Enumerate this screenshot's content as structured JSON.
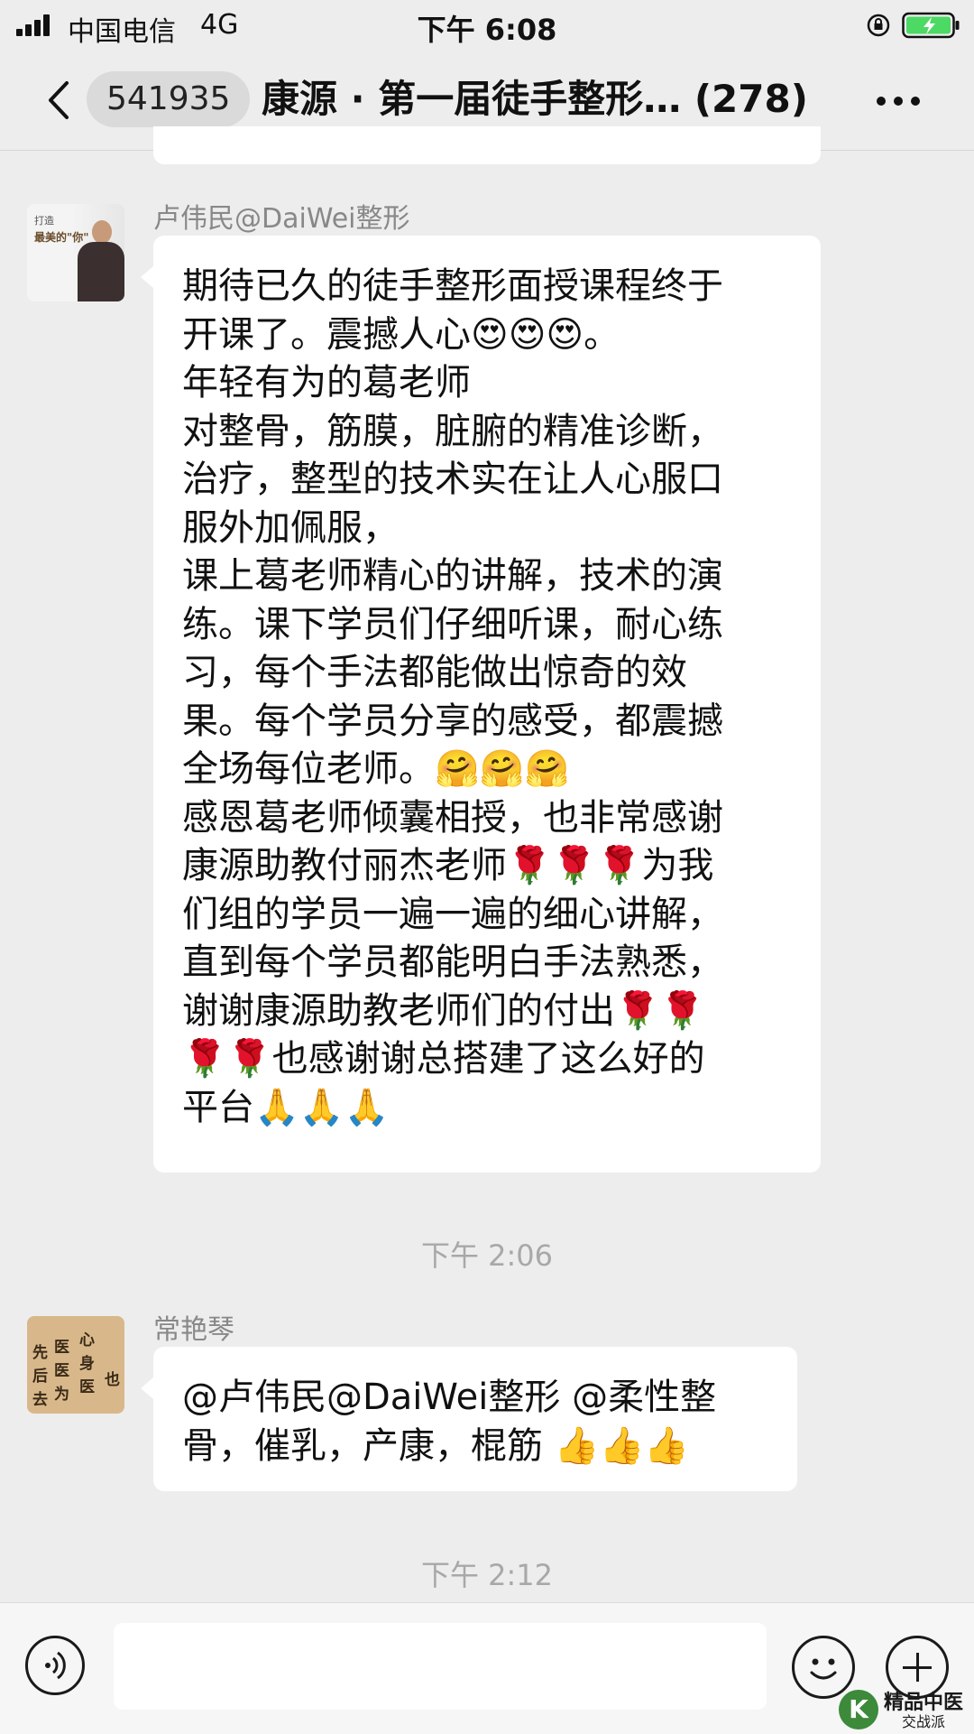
{
  "status_bar": {
    "carrier": "中国电信",
    "network": "4G",
    "time": "下午 6:08"
  },
  "nav": {
    "back_icon": "chevron-left-icon",
    "badge": "541935",
    "title": "康源 · 第一届徒手整形… (278)",
    "more_icon": "more-dots-icon"
  },
  "messages": [
    {
      "sender": "卢伟民@DaiWei整形",
      "avatar_text_1": "打造",
      "avatar_text_2": "最美的\"你\"",
      "text": "期待已久的徒手整形面授课程终于\n开课了。震撼人心😍😍😍。\n年轻有为的葛老师\n对整骨，筋膜，脏腑的精准诊断，\n治疗，整型的技术实在让人心服口\n服外加佩服，\n课上葛老师精心的讲解，技术的演\n练。课下学员们仔细听课，耐心练\n习，每个手法都能做出惊奇的效\n果。每个学员分享的感受，都震撼\n全场每位老师。🤗🤗🤗\n感恩葛老师倾囊相授，也非常感谢\n康源助教付丽杰老师🌹🌹🌹为我\n们组的学员一遍一遍的细心讲解，\n直到每个学员都能明白手法熟悉，\n谢谢康源助教老师们的付出🌹🌹\n🌹🌹也感谢谢总搭建了这么好的\n平台🙏🙏🙏"
    },
    {
      "timestamp": "下午 2:06"
    },
    {
      "sender": "常艳琴",
      "avatar_chars": [
        "先",
        "医",
        "心",
        "后",
        "医",
        "身",
        "去",
        "为",
        "医",
        "也"
      ],
      "text": "@卢伟民@DaiWei整形 @柔性整\n骨，催乳，产康，棍筋 👍👍👍"
    },
    {
      "timestamp": "下午 2:12"
    }
  ],
  "input_bar": {
    "voice_icon": "voice-icon",
    "input_value": "",
    "emoji_icon": "smiley-icon",
    "plus_icon": "plus-icon"
  },
  "watermark": {
    "line1": "精品中医",
    "line2": "交战派"
  }
}
